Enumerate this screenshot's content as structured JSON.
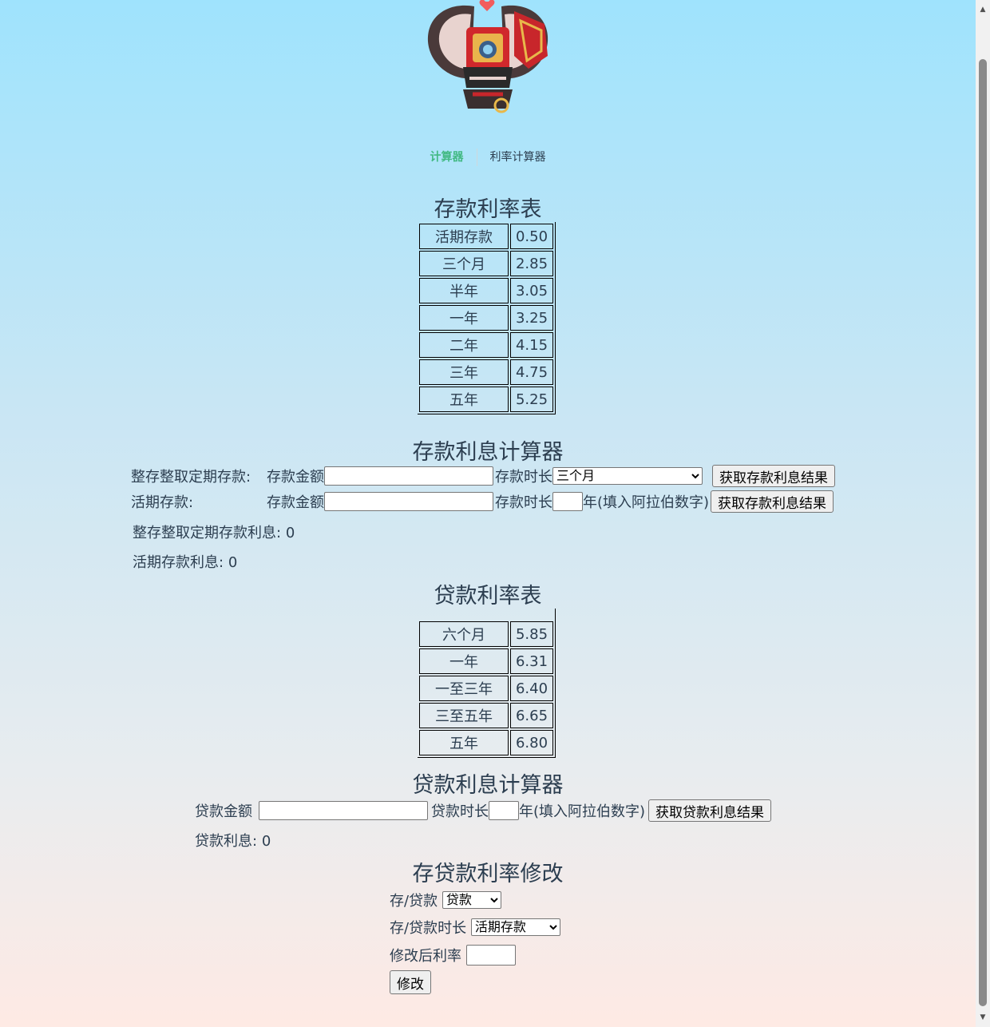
{
  "nav": {
    "calculator": "计算器",
    "rate_calculator": "利率计算器"
  },
  "deposit_table": {
    "title": "存款利率表",
    "rows": [
      {
        "term": "活期存款",
        "rate": "0.50"
      },
      {
        "term": "三个月",
        "rate": "2.85"
      },
      {
        "term": "半年",
        "rate": "3.05"
      },
      {
        "term": "一年",
        "rate": "3.25"
      },
      {
        "term": "二年",
        "rate": "4.15"
      },
      {
        "term": "三年",
        "rate": "4.75"
      },
      {
        "term": "五年",
        "rate": "5.25"
      }
    ]
  },
  "deposit_calc": {
    "title": "存款利息计算器",
    "fixed_label": "整存整取定期存款:",
    "current_label": "活期存款:",
    "amount_label": "存款金额",
    "term_label": "存款时长",
    "term_selected": "三个月",
    "year_hint": "年(填入阿拉伯数字)",
    "button": "获取存款利息结果",
    "fixed_result_label": "整存整取定期存款利息:",
    "fixed_result": "0",
    "current_result_label": "活期存款利息:",
    "current_result": "0"
  },
  "loan_table": {
    "title": "贷款利率表",
    "rows": [
      {
        "term": "六个月",
        "rate": "5.85"
      },
      {
        "term": "一年",
        "rate": "6.31"
      },
      {
        "term": "一至三年",
        "rate": "6.40"
      },
      {
        "term": "三至五年",
        "rate": "6.65"
      },
      {
        "term": "五年",
        "rate": "6.80"
      }
    ]
  },
  "loan_calc": {
    "title": "贷款利息计算器",
    "amount_label": "贷款金额",
    "term_label": "贷款时长",
    "year_hint": "年(填入阿拉伯数字)",
    "button": "获取贷款利息结果",
    "result_label": "贷款利息:",
    "result": "0"
  },
  "modify": {
    "title": "存贷款利率修改",
    "type_label": "存/贷款",
    "type_selected": "贷款",
    "term_label": "存/贷款时长",
    "term_selected": "活期存款",
    "new_rate_label": "修改后利率",
    "button": "修改"
  }
}
